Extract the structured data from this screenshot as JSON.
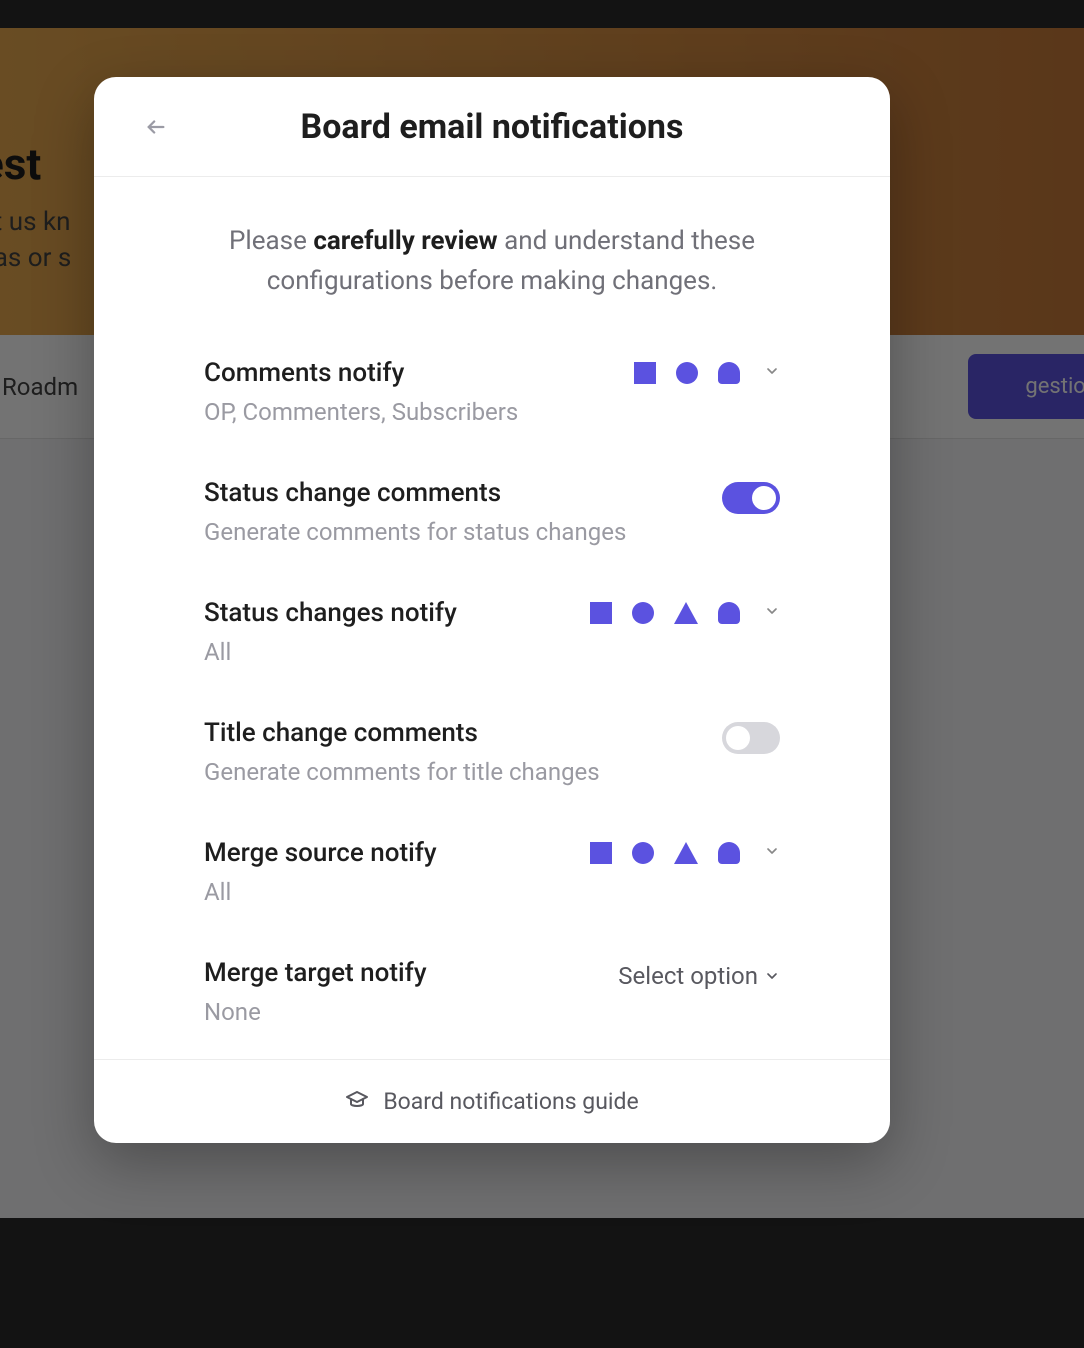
{
  "background": {
    "hero_title_fragment": "est",
    "hero_sub_line1_fragment": "et us kn",
    "hero_sub_line2_fragment": "eas or s",
    "tab_fragment": "Roadm",
    "button_fragment": "gestion"
  },
  "modal": {
    "title": "Board email notifications",
    "intro_pre": "Please ",
    "intro_strong": "carefully review",
    "intro_post": " and understand these configurations before making changes.",
    "settings": {
      "comments_notify": {
        "label": "Comments notify",
        "desc": "OP, Commenters, Subscribers",
        "icon_set": [
          "square",
          "circle",
          "dome"
        ]
      },
      "status_change_comments": {
        "label": "Status change comments",
        "desc": "Generate comments for status changes",
        "toggle": true
      },
      "status_changes_notify": {
        "label": "Status changes notify",
        "desc": "All",
        "icon_set": [
          "square",
          "circle",
          "triangle",
          "dome"
        ]
      },
      "title_change_comments": {
        "label": "Title change comments",
        "desc": "Generate comments for title changes",
        "toggle": false
      },
      "merge_source_notify": {
        "label": "Merge source notify",
        "desc": "All",
        "icon_set": [
          "square",
          "circle",
          "triangle",
          "dome"
        ]
      },
      "merge_target_notify": {
        "label": "Merge target notify",
        "desc": "None",
        "select_placeholder": "Select option"
      }
    },
    "footer_link": "Board notifications guide"
  },
  "colors": {
    "accent": "#5b52e0"
  }
}
